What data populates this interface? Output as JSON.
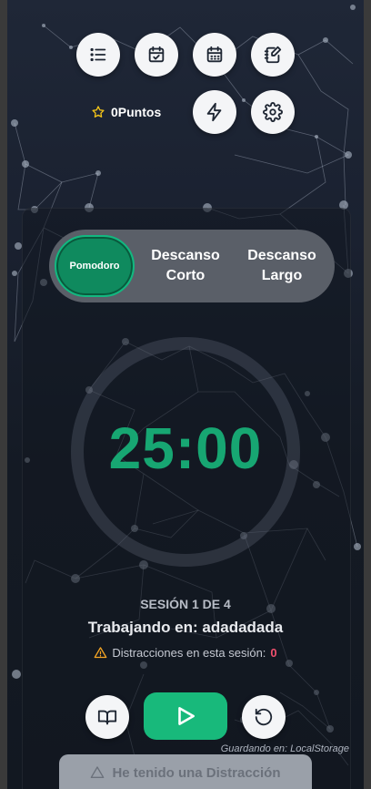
{
  "toolbar": {
    "items": [
      {
        "name": "list-icon"
      },
      {
        "name": "calendar-check-icon"
      },
      {
        "name": "calendar-grid-icon"
      },
      {
        "name": "notebook-edit-icon"
      },
      {
        "name": "lightning-icon"
      },
      {
        "name": "gear-icon"
      }
    ]
  },
  "points": {
    "label": "0Puntos",
    "icon": "star-icon",
    "icon_color": "#f5c518"
  },
  "modes": {
    "active": "Pomodoro",
    "short_break_line1": "Descanso",
    "short_break_line2": "Corto",
    "long_break_line1": "Descanso",
    "long_break_line2": "Largo"
  },
  "timer": {
    "display": "25:00",
    "color": "#17a672"
  },
  "session": {
    "label": "SESIÓN 1 DE 4",
    "working_on": "Trabajando en: adadadada",
    "distractions_label": "Distracciones en esta sesión:",
    "distractions_count": "0",
    "warning_color": "#f5a524",
    "count_color": "#f0506e"
  },
  "controls": {
    "book": "book-icon",
    "play": "play-icon",
    "reset": "reset-icon",
    "play_color": "#18b97b"
  },
  "saving": {
    "text": "Guardando en: LocalStorage"
  },
  "distraction_button": {
    "label": "He tenido una Distracción"
  }
}
